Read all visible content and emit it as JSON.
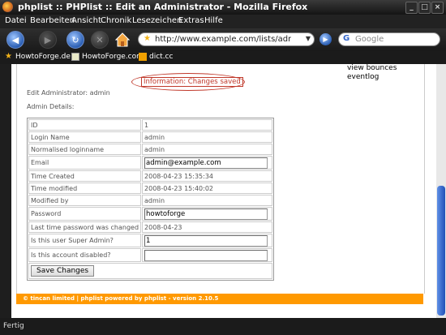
{
  "window": {
    "title": "phplist :: PHPlist :: Edit an Administrator - Mozilla Firefox",
    "minimize": "_",
    "maximize": "□",
    "close": "×"
  },
  "menu": [
    "Datei",
    "Bearbeiten",
    "Ansicht",
    "Chronik",
    "Lesezeichen",
    "Extras",
    "Hilfe"
  ],
  "nav": {
    "url": "http://www.example.com/lists/admin/?page=",
    "search_placeholder": "Google"
  },
  "bookmarks": [
    "HowtoForge.de",
    "HowtoForge.com",
    "dict.cc"
  ],
  "sidebar_menu": [
    "view bounces",
    "eventlog"
  ],
  "info_message": "Information: Changes saved",
  "edit_label": "Edit Administrator: admin",
  "details_label": "Admin Details:",
  "rows": [
    {
      "key": "ID",
      "value": "1",
      "editable": false
    },
    {
      "key": "Login Name",
      "value": "admin",
      "editable": false
    },
    {
      "key": "Normalised loginname",
      "value": "admin",
      "editable": false
    },
    {
      "key": "Email",
      "value": "admin@example.com",
      "editable": true
    },
    {
      "key": "Time Created",
      "value": "2008-04-23 15:35:34",
      "editable": false
    },
    {
      "key": "Time modified",
      "value": "2008-04-23 15:40:02",
      "editable": false
    },
    {
      "key": "Modified by",
      "value": "admin",
      "editable": false
    },
    {
      "key": "Password",
      "value": "howtoforge",
      "editable": true
    },
    {
      "key": "Last time password was changed",
      "value": "2008-04-23",
      "editable": false
    },
    {
      "key": "Is this user Super Admin?",
      "value": "1",
      "editable": true
    },
    {
      "key": "Is this account disabled?",
      "value": "",
      "editable": true
    }
  ],
  "save_button": "Save Changes",
  "footer": "© tincan limited | phplist powered by phplist - version 2.10.5",
  "status": "Fertig"
}
